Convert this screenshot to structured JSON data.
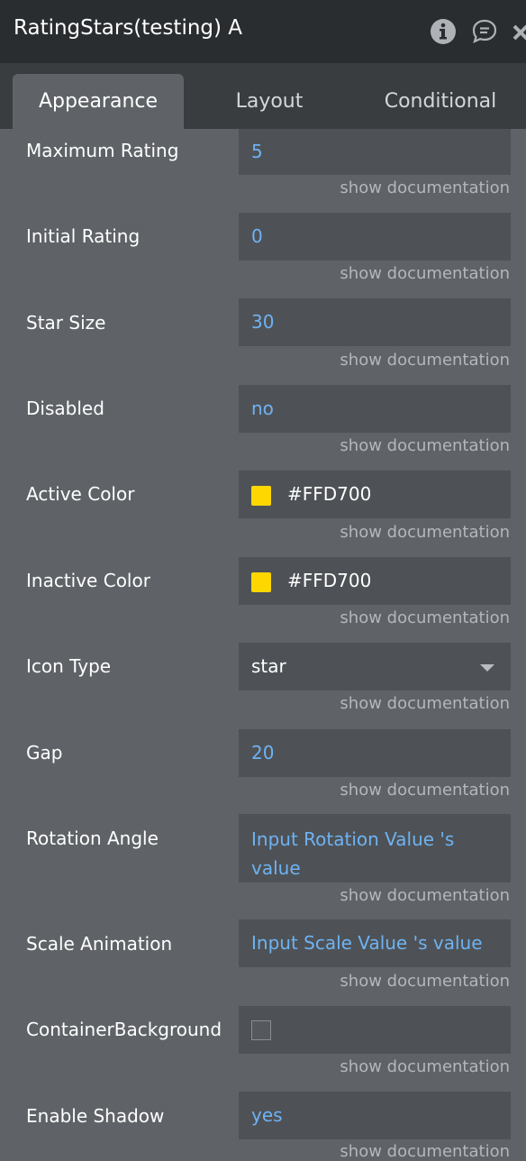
{
  "header": {
    "title": "RatingStars(testing) A"
  },
  "tabs": [
    "Appearance",
    "Layout",
    "Conditional"
  ],
  "doc_link": "show documentation",
  "properties": {
    "maximum_rating": {
      "label": "Maximum Rating",
      "value": "5"
    },
    "initial_rating": {
      "label": "Initial Rating",
      "value": "0"
    },
    "star_size": {
      "label": "Star Size",
      "value": "30"
    },
    "disabled": {
      "label": "Disabled",
      "value": "no"
    },
    "active_color": {
      "label": "Active Color",
      "value": "#FFD700",
      "swatch": "#FFD700"
    },
    "inactive_color": {
      "label": "Inactive Color",
      "value": "#FFD700",
      "swatch": "#FFD700"
    },
    "icon_type": {
      "label": "Icon Type",
      "value": "star"
    },
    "gap": {
      "label": "Gap",
      "value": "20"
    },
    "rotation_angle": {
      "label": "Rotation Angle",
      "value": "Input Rotation Value 's value"
    },
    "scale_animation": {
      "label": "Scale Animation",
      "value": "Input Scale Value 's value"
    },
    "container_background": {
      "label": "ContainerBackground",
      "checked": false
    },
    "enable_shadow": {
      "label": "Enable Shadow",
      "value": "yes"
    }
  },
  "colors": {
    "header_bg": "#2a2d30",
    "panel_bg": "#5f6367",
    "field_bg": "#4e5256",
    "link_blue": "#6fb2f2",
    "doc_gray": "#b3b7bb"
  },
  "icons": [
    "info-icon",
    "comment-icon",
    "close-icon",
    "chevron-down-icon"
  ]
}
